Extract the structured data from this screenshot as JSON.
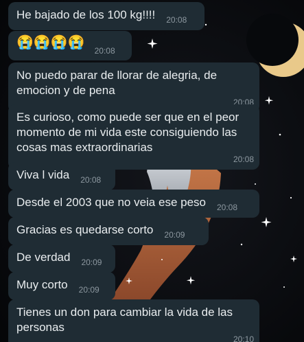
{
  "messages": [
    {
      "text": "He bajado de los 100 kg!!!!",
      "time": "20:08"
    },
    {
      "text": "😭😭😭😭",
      "time": "20:08"
    },
    {
      "text": "No puedo parar de llorar de alegria, de emocion y de pena",
      "time": "20:08"
    },
    {
      "text": "Es curioso, como puede ser que en el peor momento de mi vida este consiguiendo las cosas mas extraordinarias",
      "time": "20:08"
    },
    {
      "text": "Viva l vida",
      "time": "20:08"
    },
    {
      "text": "Desde el 2003 que no veia ese peso",
      "time": "20:08"
    },
    {
      "text": "Gracias es quedarse corto",
      "time": "20:09"
    },
    {
      "text": "De verdad",
      "time": "20:09"
    },
    {
      "text": "Muy corto",
      "time": "20:09"
    },
    {
      "text": "Tienes un don para cambiar la vida de las personas",
      "time": "20:10"
    }
  ],
  "colors": {
    "bubble": "#1f2c34",
    "text": "#e9edef",
    "timestamp": "#8d98a0",
    "moon": "#e9c98a"
  }
}
